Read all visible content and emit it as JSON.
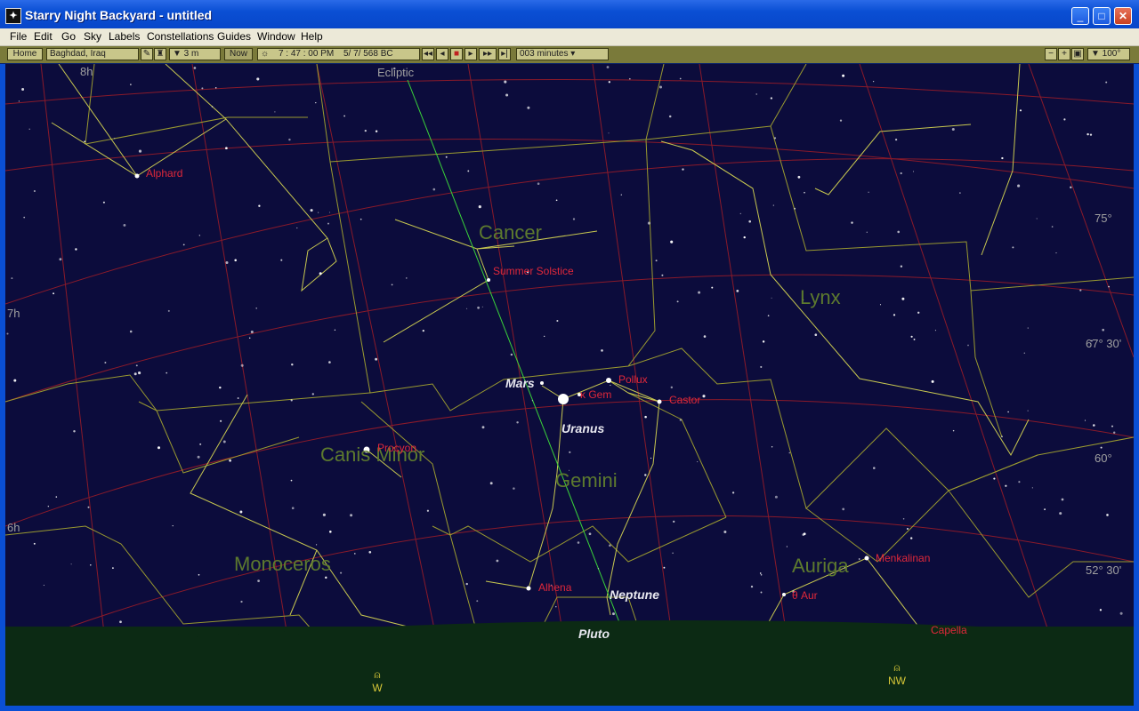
{
  "window": {
    "title": "Starry Night Backyard - untitled",
    "minimize": "_",
    "maximize": "□",
    "close": "✕"
  },
  "menu": [
    "File",
    "Edit",
    "Go",
    "Sky",
    "Labels",
    "Constellations",
    "Guides",
    "Window",
    "Help"
  ],
  "toolbar": {
    "home": "Home",
    "location": "Baghdad, Iraq",
    "elevation": "▼ 3 m",
    "now": "Now",
    "time": "7 : 47 : 00 PM",
    "date": "5/  7/  568 BC",
    "step": "003 minutes ▾",
    "fov": "▼ 100°"
  },
  "sky": {
    "ecliptic_label": "Ecliptic",
    "ra_labels": [
      "8h",
      "7h",
      "6h"
    ],
    "dec_labels": [
      "75°",
      "67° 30'",
      "60°",
      "52° 30'"
    ],
    "constellations": [
      "Cancer",
      "Lynx",
      "Canis Minor",
      "Gemini",
      "Monoceros",
      "Auriga"
    ],
    "stars": [
      "Alphard",
      "Summer Solstice",
      "Pollux",
      "κ Gem",
      "Castor",
      "Procyon",
      "Alhena",
      "Menkalinan",
      "θ Aur",
      "Capella"
    ],
    "planets": [
      "Mars",
      "Uranus",
      "Neptune",
      "Pluto"
    ],
    "compass": [
      "W",
      "NW"
    ]
  },
  "colors": {
    "sky": "#0c0c3c",
    "ground": "#0c2a14",
    "constellation_lines": "#c8c850",
    "boundaries": "#9a9a30",
    "grid": "#8a1a2a",
    "ecliptic": "#3ad23a",
    "star_labels": "#e0283a"
  }
}
